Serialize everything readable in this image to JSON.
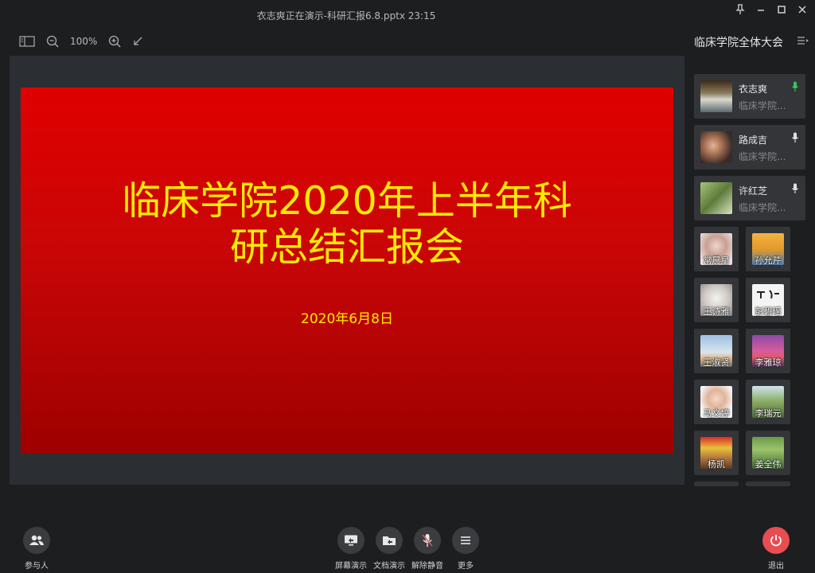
{
  "window": {
    "title": "衣志爽正在演示-科研汇报6.8.pptx 23:15"
  },
  "toolbar": {
    "zoom": "100%"
  },
  "slide": {
    "title": "临床学院2020年上半年科研总结汇报会",
    "date": "2020年6月8日"
  },
  "sidebar": {
    "meeting_name": "临床学院全体大会",
    "speakers": [
      {
        "name": "衣志爽",
        "subtitle": "临床学院...",
        "mic": "active"
      },
      {
        "name": "路成吉",
        "subtitle": "临床学院...",
        "mic": "on"
      },
      {
        "name": "许红芝",
        "subtitle": "临床学院...",
        "mic": "on"
      }
    ],
    "attendees": [
      {
        "name": "常晨星"
      },
      {
        "name": "孙允芹"
      },
      {
        "name": "王诗雅"
      },
      {
        "name": "彭碧瑶"
      },
      {
        "name": "王淑贤"
      },
      {
        "name": "李雅琼"
      },
      {
        "name": "马文婷"
      },
      {
        "name": "李瑞元"
      },
      {
        "name": "杨凯"
      },
      {
        "name": "姜全伟"
      }
    ]
  },
  "bottombar": {
    "participants_label": "参与人",
    "screen_share_label": "屏幕演示",
    "doc_share_label": "文档演示",
    "unmute_label": "解除静音",
    "more_label": "更多",
    "leave_label": "退出"
  },
  "colors": {
    "mic_active": "#35c759",
    "leave": "#e84d52",
    "slide_text": "#ffeb00",
    "slide_bg": "#d40000"
  }
}
